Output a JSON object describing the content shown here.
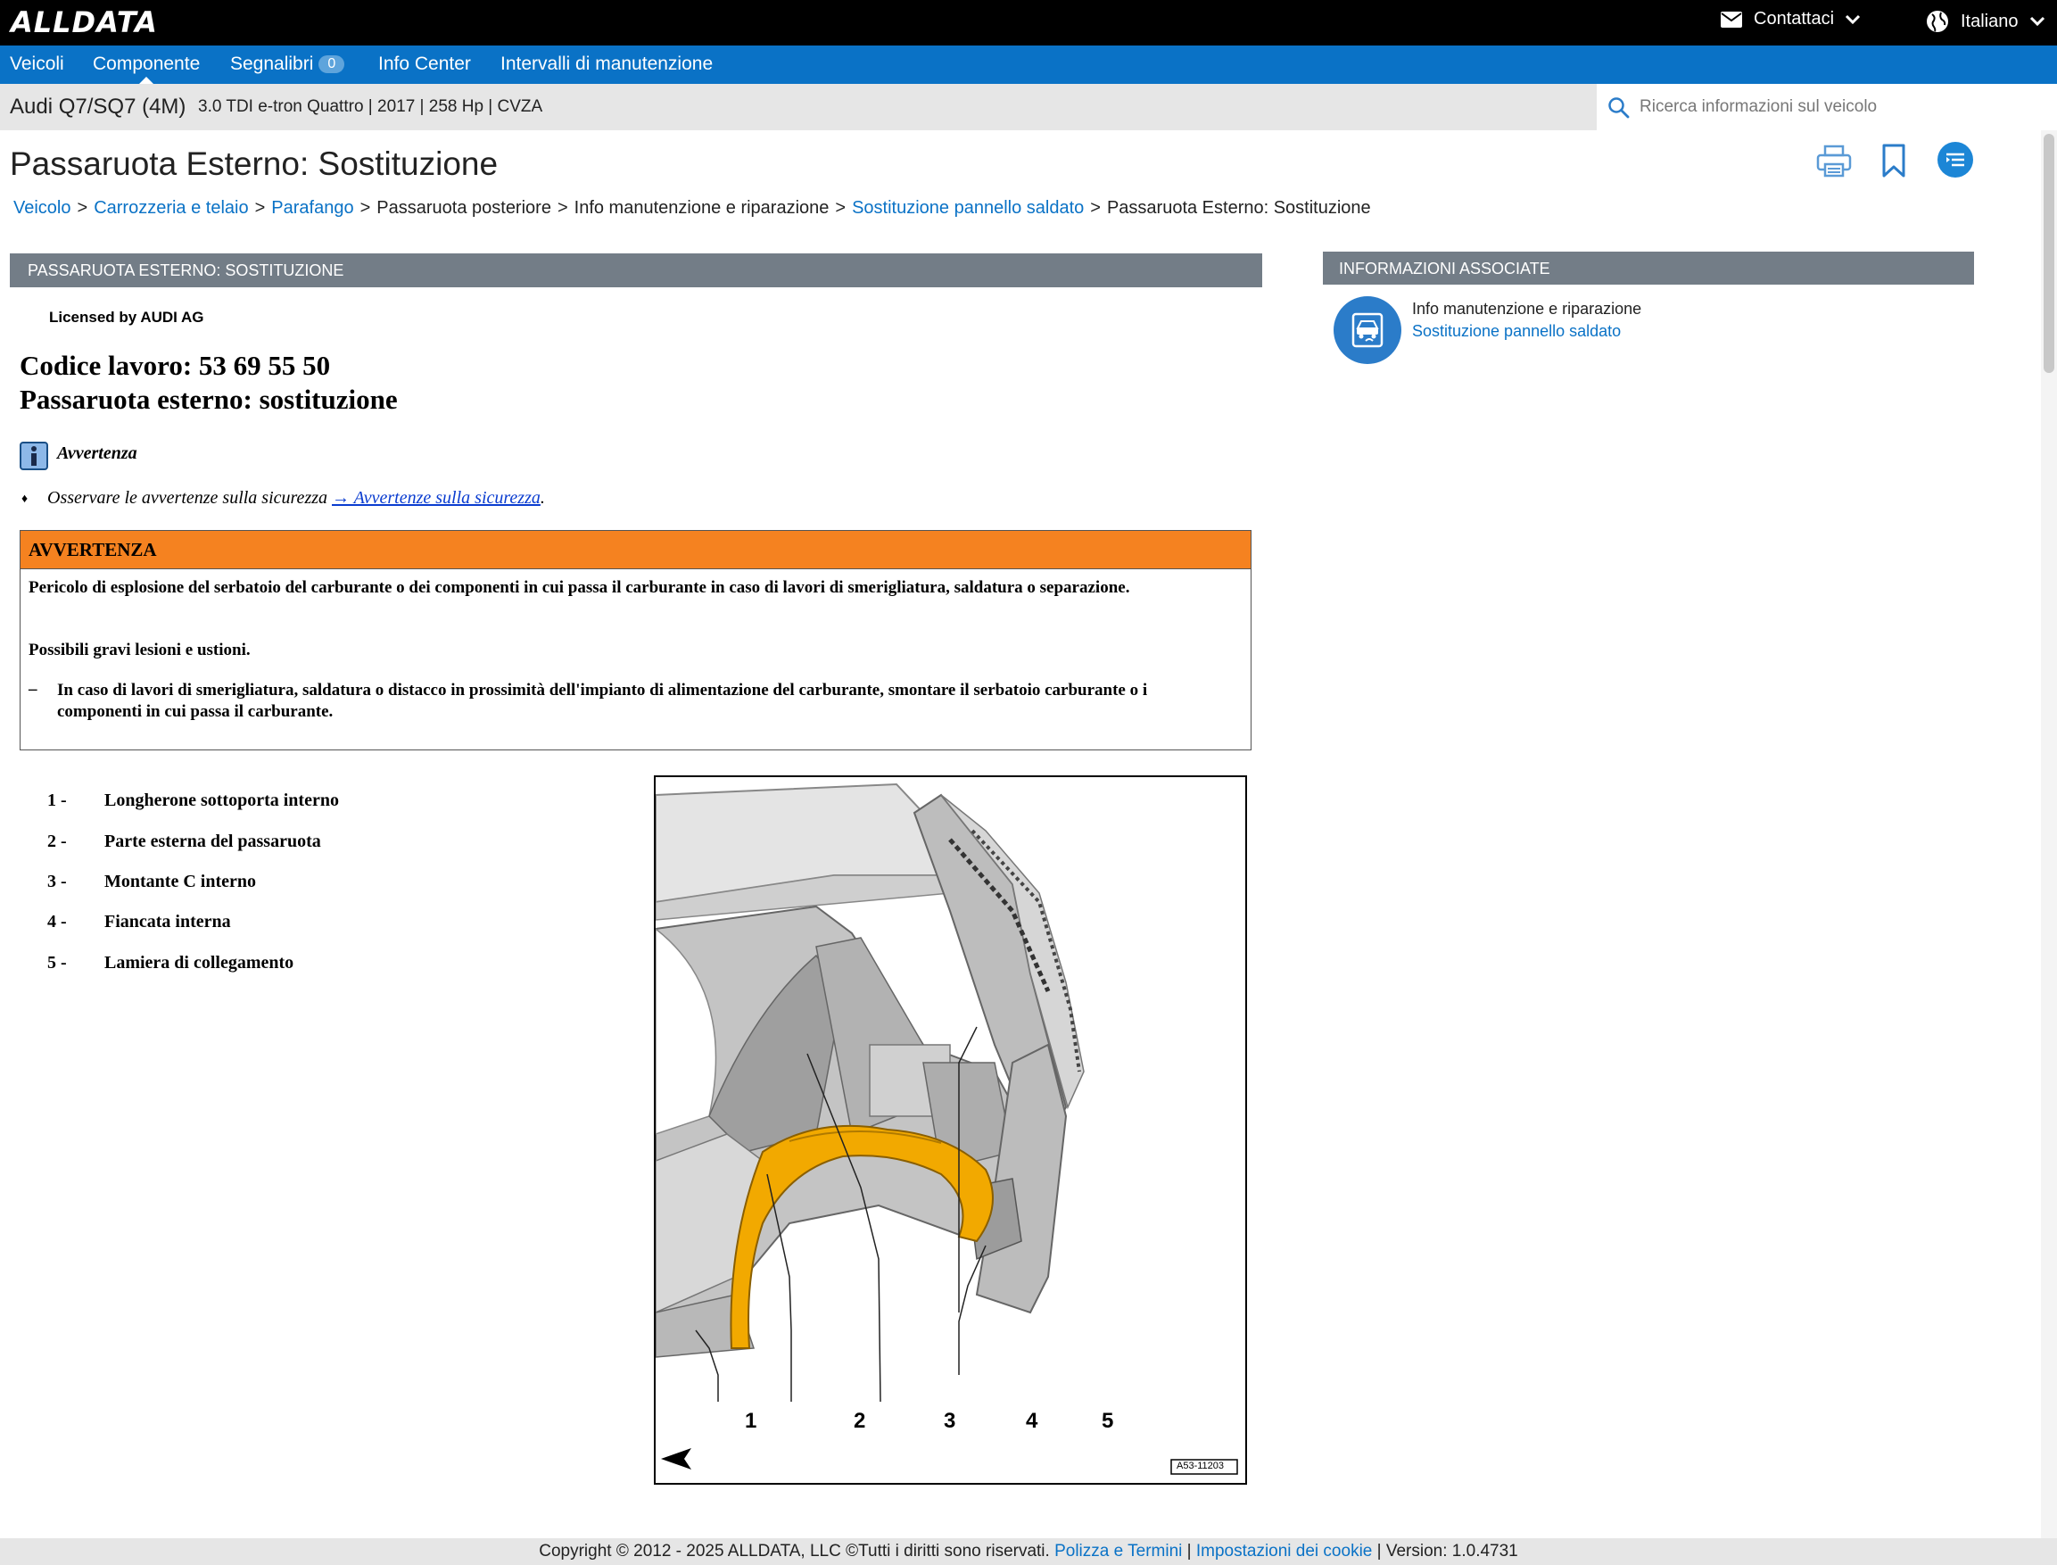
{
  "brand": {
    "logo": "ALLDATA"
  },
  "header": {
    "contact_label": "Contattaci",
    "language_label": "Italiano"
  },
  "nav": {
    "items": [
      {
        "label": "Veicoli"
      },
      {
        "label": "Componente"
      },
      {
        "label": "Segnalibri"
      },
      {
        "label": "Info Center"
      },
      {
        "label": "Intervalli di manutenzione"
      }
    ],
    "bookmark_count": "0",
    "active": "Componente"
  },
  "vehicle": {
    "name": "Audi Q7/SQ7 (4M)",
    "spec": "3.0 TDI e-tron Quattro | 2017 | 258 Hp | CVZA"
  },
  "search": {
    "placeholder": "Ricerca informazioni sul veicolo"
  },
  "page": {
    "title": "Passaruota Esterno: Sostituzione"
  },
  "breadcrumb": [
    {
      "label": "Veicolo",
      "link": true
    },
    {
      "label": "Carrozzeria e telaio",
      "link": true
    },
    {
      "label": "Parafango",
      "link": true
    },
    {
      "label": "Passaruota posteriore",
      "link": false
    },
    {
      "label": "Info manutenzione e riparazione",
      "link": false
    },
    {
      "label": "Sostituzione pannello saldato",
      "link": true
    },
    {
      "label": "Passaruota Esterno: Sostituzione",
      "link": false
    }
  ],
  "section": {
    "header": "PASSARUOTA ESTERNO: SOSTITUZIONE",
    "licensed": "Licensed by AUDI AG"
  },
  "doc": {
    "code_line": "Codice lavoro: 53 69 55 50",
    "title_line": "Passaruota esterno: sostituzione",
    "note_label": "Avvertenza",
    "bullet": "♦",
    "note_text": "Osservare le avvertenze sulla sicurezza ",
    "note_link": "→ Avvertenze sulla sicurezza",
    "note_end": "."
  },
  "warning": {
    "title": "AVVERTENZA",
    "p1": "Pericolo di esplosione del serbatoio del carburante o dei componenti in cui passa il carburante in caso di lavori di smerigliatura, saldatura o separazione.",
    "p2": "Possibili gravi lesioni e ustioni.",
    "dash": "–",
    "item": "In caso di lavori di smerigliatura, saldatura o distacco in prossimità dell'impianto di alimentazione del carburante, smontare il serbatoio carburante o i componenti in cui passa il carburante."
  },
  "legend": [
    {
      "num": "1 -",
      "label": "Longherone sottoporta interno"
    },
    {
      "num": "2 -",
      "label": "Parte esterna del passaruota"
    },
    {
      "num": "3 -",
      "label": "Montante C interno"
    },
    {
      "num": "4 -",
      "label": "Fiancata interna"
    },
    {
      "num": "5 -",
      "label": "Lamiera di collegamento"
    }
  ],
  "figure": {
    "callouts": [
      "1",
      "2",
      "3",
      "4",
      "5"
    ],
    "ref": "A53-11203",
    "highlight_color": "#f2a900"
  },
  "related": {
    "header": "INFORMAZIONI ASSOCIATE",
    "category": "Info manutenzione e riparazione",
    "link": "Sostituzione pannello saldato"
  },
  "footer": {
    "copyright": "Copyright © 2012 - 2025 ALLDATA, LLC ©Tutti i diritti sono riservati. ",
    "policy_link": "Polizza e Termini",
    "sep": " | ",
    "cookie_link": "Impostazioni dei cookie",
    "version": "Version: 1.0.4731"
  },
  "colors": {
    "nav_blue": "#0a72c6",
    "section_gray": "#737d87",
    "warning_orange": "#f58220"
  },
  "icons": [
    "mail-icon",
    "chevron-down-icon",
    "globe-icon",
    "search-icon",
    "print-icon",
    "bookmark-icon",
    "list-icon",
    "info-icon",
    "vehicle-service-icon"
  ]
}
